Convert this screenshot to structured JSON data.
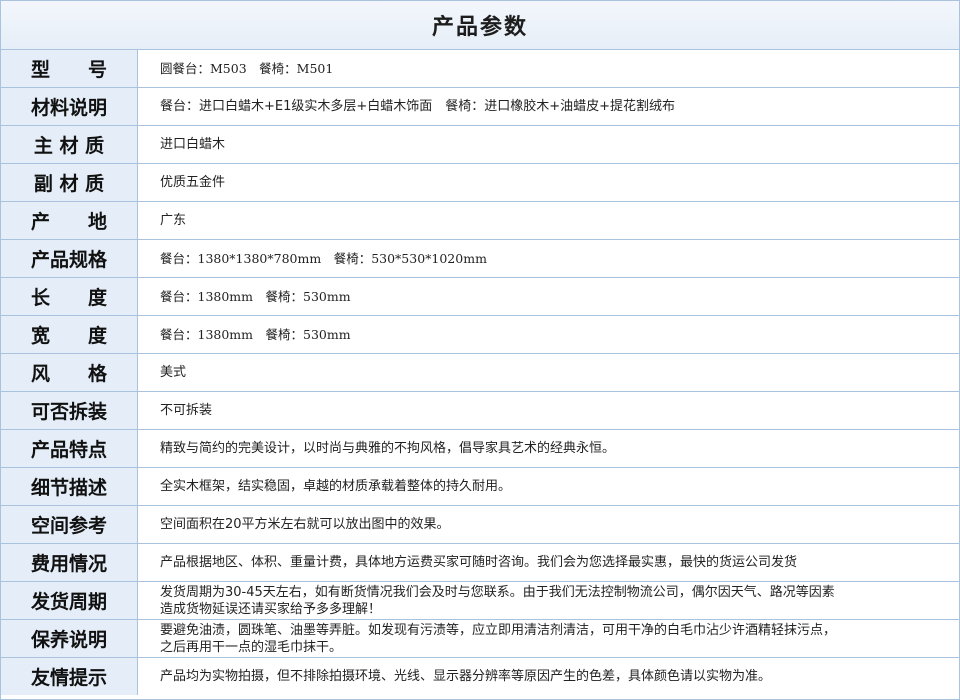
{
  "title": "产品参数",
  "rows": [
    {
      "label": "型　　号",
      "value": "圆餐台：M503　餐椅：M501"
    },
    {
      "label": "材料说明",
      "value": "餐台：进口白蜡木+E1级实木多层+白蜡木饰面　餐椅：进口橡胶木+油蜡皮+提花割绒布"
    },
    {
      "label": "主 材 质",
      "value": "进口白蜡木"
    },
    {
      "label": "副 材 质",
      "value": "优质五金件"
    },
    {
      "label": "产　　地",
      "value": "广东"
    },
    {
      "label": "产品规格",
      "value": "餐台：1380*1380*780mm　餐椅：530*530*1020mm"
    },
    {
      "label": "长　　度",
      "value": "餐台：1380mm　餐椅：530mm"
    },
    {
      "label": "宽　　度",
      "value": "餐台：1380mm　餐椅：530mm"
    },
    {
      "label": "风　　格",
      "value": "美式"
    },
    {
      "label": "可否拆装",
      "value": "不可拆装"
    },
    {
      "label": "产品特点",
      "value": "精致与简约的完美设计，以时尚与典雅的不拘风格，倡导家具艺术的经典永恒。"
    },
    {
      "label": "细节描述",
      "value": "全实木框架，结实稳固，卓越的材质承载着整体的持久耐用。"
    },
    {
      "label": "空间参考",
      "value": "空间面积在20平方米左右就可以放出图中的效果。"
    },
    {
      "label": "费用情况",
      "value": "产品根据地区、体积、重量计费，具体地方运费买家可随时咨询。我们会为您选择最实惠，最快的货运公司发货"
    },
    {
      "label": "发货周期",
      "value": "发货周期为30-45天左右，如有断货情况我们会及时与您联系。由于我们无法控制物流公司，偶尔因天气、路况等因素\n造成货物延误还请买家给予多多理解！"
    },
    {
      "label": "保养说明",
      "value": "要避免油渍，圆珠笔、油墨等弄脏。如发现有污渍等，应立即用清洁剂清洁，可用干净的白毛巾沾少许酒精轻抹污点，\n之后再用干一点的湿毛巾抹干。"
    },
    {
      "label": "友情提示",
      "value": "产品均为实物拍摄，但不排除拍摄环境、光线、显示器分辨率等原因产生的色差，具体颜色请以实物为准。"
    }
  ]
}
